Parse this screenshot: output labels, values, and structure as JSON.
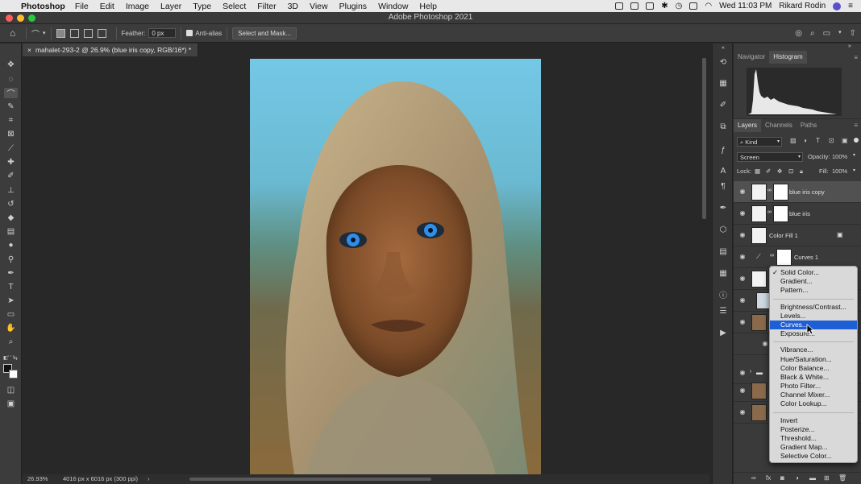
{
  "menubar": {
    "app_name": "Photoshop",
    "items": [
      "File",
      "Edit",
      "Image",
      "Layer",
      "Type",
      "Select",
      "Filter",
      "3D",
      "View",
      "Plugins",
      "Window",
      "Help"
    ],
    "clock": "Wed 11:03 PM",
    "user": "Rikard Rodin"
  },
  "window": {
    "title": "Adobe Photoshop 2021"
  },
  "options_bar": {
    "feather_label": "Feather:",
    "feather_value": "0 px",
    "antialias_label": "Anti-alias",
    "select_mask_label": "Select and Mask..."
  },
  "document": {
    "tab_title": "mahalet-293-2 @ 26.9% (blue iris copy, RGB/16*) *",
    "zoom": "26.93%",
    "dimensions": "4016 px x 6016 px (300 ppi)"
  },
  "panels": {
    "top_tabs": [
      "Navigator",
      "Histogram"
    ],
    "layer_tabs": [
      "Layers",
      "Channels",
      "Paths"
    ],
    "kind_filter": "Kind",
    "blend_mode": "Screen",
    "opacity_label": "Opacity:",
    "opacity_value": "100%",
    "lock_label": "Lock:",
    "fill_label": "Fill:",
    "fill_value": "100%"
  },
  "layers": [
    {
      "name": "blue iris copy",
      "selected": true
    },
    {
      "name": "blue iris",
      "selected": false
    },
    {
      "name": "Color Fill 1",
      "selected": false
    },
    {
      "name": "Curves 1",
      "selected": false
    }
  ],
  "adjustment_menu": {
    "groups": [
      [
        "Solid Color...",
        "Gradient...",
        "Pattern..."
      ],
      [
        "Brightness/Contrast...",
        "Levels...",
        "Curves...",
        "Exposure..."
      ],
      [
        "Vibrance...",
        "Hue/Saturation...",
        "Color Balance...",
        "Black & White...",
        "Photo Filter...",
        "Channel Mixer...",
        "Color Lookup..."
      ],
      [
        "Invert",
        "Posterize...",
        "Threshold...",
        "Gradient Map...",
        "Selective Color..."
      ]
    ],
    "checked": "Solid Color...",
    "highlighted": "Curves..."
  },
  "colors": {
    "accent": "#1f5fd6",
    "ui_dark": "#282828",
    "panel": "#3a3a3a"
  }
}
